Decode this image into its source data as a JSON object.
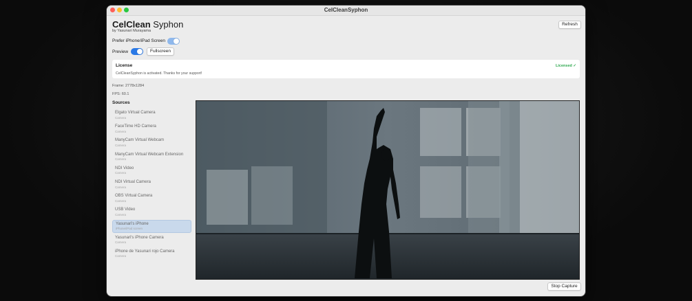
{
  "window": {
    "title": "CelCleanSyphon"
  },
  "header": {
    "app_name_bold": "CelClean",
    "app_name_rest": "Syphon",
    "byline": "by Yasunari Murayama",
    "refresh_label": "Refresh"
  },
  "settings": {
    "prefer_label": "Prefer iPhone/iPad Screen",
    "prefer_on": true,
    "preview_label": "Preview",
    "preview_on": true,
    "fullscreen_label": "Fullscreen"
  },
  "license": {
    "title": "License",
    "message": "CelCleanSyphon is activated. Thanks for your support!",
    "status": "Licensed ✓"
  },
  "stats": {
    "frame": "Frame: 2778x1284",
    "fps": "FPS: 60.1"
  },
  "sources": {
    "heading": "Sources",
    "items": [
      {
        "name": "Elgato Virtual Camera",
        "type": "Camera"
      },
      {
        "name": "FaceTime HD Camera",
        "type": "Camera"
      },
      {
        "name": "ManyCam Virtual Webcam",
        "type": "Camera"
      },
      {
        "name": "ManyCam Virtual Webcam Extension",
        "type": "Camera"
      },
      {
        "name": "NDI Video",
        "type": "Camera"
      },
      {
        "name": "NDI Virtual Camera",
        "type": "Camera"
      },
      {
        "name": "OBS Virtual Camera",
        "type": "Camera"
      },
      {
        "name": "USB Video",
        "type": "Camera"
      },
      {
        "name": "Yasunari's iPhone",
        "type": "iPhone/iPad screen"
      },
      {
        "name": "Yasunari's iPhone Camera",
        "type": "Camera"
      },
      {
        "name": "iPhone de Yasunari rojo Camera",
        "type": "Camera"
      }
    ],
    "selected_index": 8
  },
  "footer": {
    "stop_label": "Stop Capture"
  },
  "colors": {
    "accent": "#2a79e6",
    "selected_bg": "#c9d9ec",
    "licensed_green": "#2fa84f"
  },
  "icons": [
    "close-icon",
    "minimize-icon",
    "zoom-icon",
    "checkmark-icon"
  ]
}
